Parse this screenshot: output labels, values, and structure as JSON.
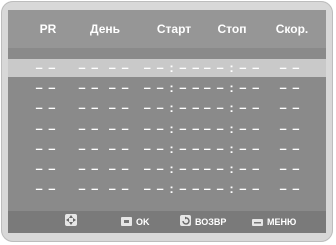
{
  "headers": [
    "PR",
    "День",
    "Старт",
    "Стоп",
    "Скор."
  ],
  "rows": [
    {
      "pr": "– –",
      "day": "– –  – –",
      "start": "– – : – –",
      "stop": "– – : – –",
      "speed": "– –"
    },
    {
      "pr": "– –",
      "day": "– –  – –",
      "start": "– – : – –",
      "stop": "– – : – –",
      "speed": "– –"
    },
    {
      "pr": "– –",
      "day": "– –  – –",
      "start": "– – : – –",
      "stop": "– – : – –",
      "speed": "– –"
    },
    {
      "pr": "– –",
      "day": "– –  – –",
      "start": "– – : – –",
      "stop": "– – : – –",
      "speed": "– –"
    },
    {
      "pr": "– –",
      "day": "– –  – –",
      "start": "– – : – –",
      "stop": "– – : – –",
      "speed": "– –"
    },
    {
      "pr": "– –",
      "day": "– –  – –",
      "start": "– – : – –",
      "stop": "– – : – –",
      "speed": "– –"
    },
    {
      "pr": "– –",
      "day": "– –  – –",
      "start": "– – : – –",
      "stop": "– – : – –",
      "speed": "– –"
    }
  ],
  "footer": {
    "nav_icon": "dpad-icon",
    "ok_label": "OK",
    "back_label": "ВОЗВР",
    "menu_label": "МЕНЮ"
  }
}
